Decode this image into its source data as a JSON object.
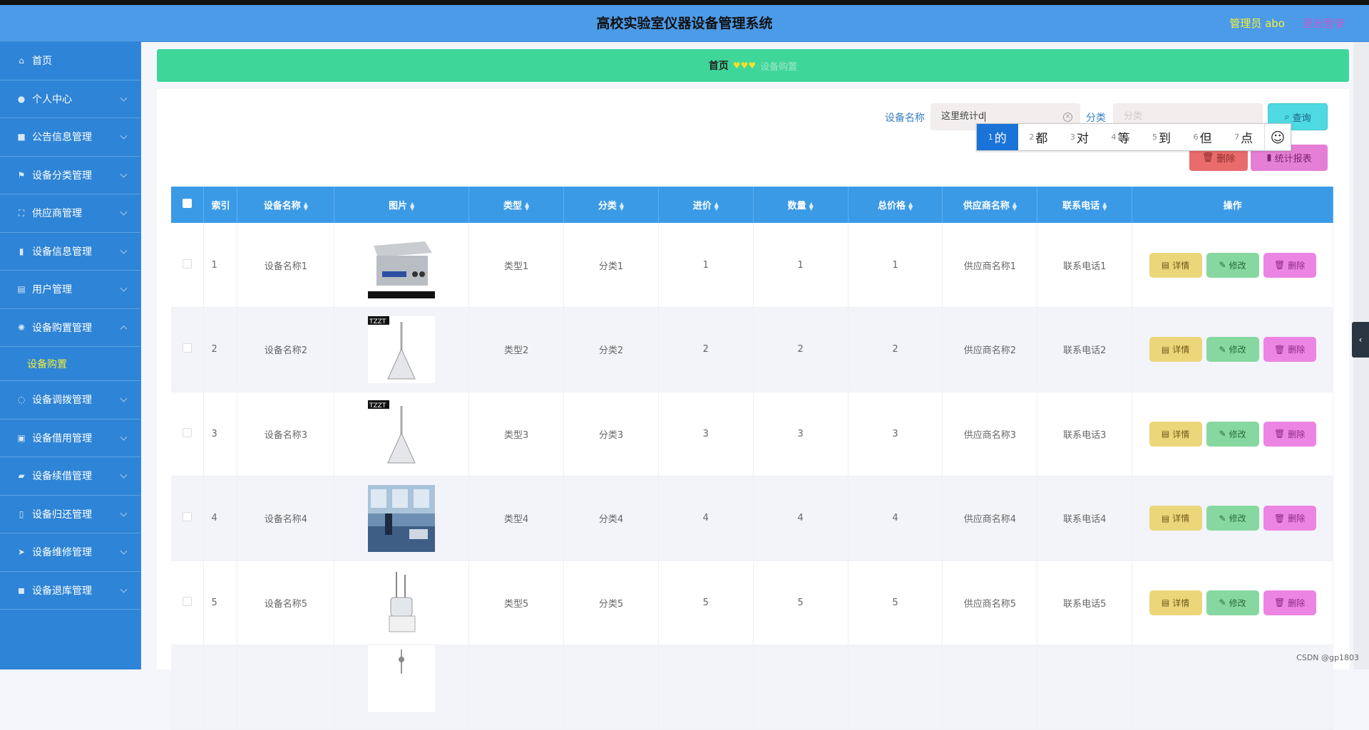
{
  "header": {
    "title": "高校实验室仪器设备管理系统",
    "admin": "管理员 abo",
    "logout": "退出登录"
  },
  "sidebar": {
    "items": [
      {
        "label": "首页",
        "icon": "home-icon",
        "glyph": "⌂"
      },
      {
        "label": "个人中心",
        "icon": "user-icon",
        "glyph": "●"
      },
      {
        "label": "公告信息管理",
        "icon": "briefcase-icon",
        "glyph": "■"
      },
      {
        "label": "设备分类管理",
        "icon": "flag-icon",
        "glyph": "⚑"
      },
      {
        "label": "供应商管理",
        "icon": "fullscreen-icon",
        "glyph": "⛶"
      },
      {
        "label": "设备信息管理",
        "icon": "bar-chart-icon",
        "glyph": "▮"
      },
      {
        "label": "用户管理",
        "icon": "document-icon",
        "glyph": "▤"
      },
      {
        "label": "设备购置管理",
        "icon": "settings-icon",
        "glyph": "✺"
      },
      {
        "label": "设备调拨管理",
        "icon": "loading-icon",
        "glyph": "◌"
      },
      {
        "label": "设备借用管理",
        "icon": "clipboard-icon",
        "glyph": "▣"
      },
      {
        "label": "设备续借管理",
        "icon": "folder-icon",
        "glyph": "▰"
      },
      {
        "label": "设备归还管理",
        "icon": "mobile-icon",
        "glyph": "▯"
      },
      {
        "label": "设备维修管理",
        "icon": "send-icon",
        "glyph": "➤"
      },
      {
        "label": "设备退库管理",
        "icon": "camera-icon",
        "glyph": "◼"
      }
    ],
    "sub_item": "设备购置"
  },
  "breadcrumb": {
    "home": "首页",
    "separator": "♥♥♥",
    "current": "设备购置"
  },
  "search": {
    "name_label": "设备名称",
    "name_value": "这里统计d",
    "category_label": "分类",
    "category_placeholder": "分类",
    "query_label": "查询"
  },
  "ime": {
    "candidates": [
      {
        "num": "1",
        "text": "的"
      },
      {
        "num": "2",
        "text": "都"
      },
      {
        "num": "3",
        "text": "对"
      },
      {
        "num": "4",
        "text": "等"
      },
      {
        "num": "5",
        "text": "到"
      },
      {
        "num": "6",
        "text": "但"
      },
      {
        "num": "7",
        "text": "点"
      }
    ],
    "emoji": "☺"
  },
  "actions": {
    "delete_label": "删除",
    "report_label": "统计报表"
  },
  "table": {
    "headers": [
      "索引",
      "设备名称",
      "图片",
      "类型",
      "分类",
      "进价",
      "数量",
      "总价格",
      "供应商名称",
      "联系电话",
      "操作"
    ],
    "row_buttons": {
      "detail": "详情",
      "edit": "修改",
      "delete": "删除"
    },
    "rows": [
      {
        "index": "1",
        "name": "设备名称1",
        "type": "类型1",
        "category": "分类1",
        "price": "1",
        "qty": "1",
        "total": "1",
        "supplier": "供应商名称1",
        "phone": "联系电话1"
      },
      {
        "index": "2",
        "name": "设备名称2",
        "type": "类型2",
        "category": "分类2",
        "price": "2",
        "qty": "2",
        "total": "2",
        "supplier": "供应商名称2",
        "phone": "联系电话2"
      },
      {
        "index": "3",
        "name": "设备名称3",
        "type": "类型3",
        "category": "分类3",
        "price": "3",
        "qty": "3",
        "total": "3",
        "supplier": "供应商名称3",
        "phone": "联系电话3"
      },
      {
        "index": "4",
        "name": "设备名称4",
        "type": "类型4",
        "category": "分类4",
        "price": "4",
        "qty": "4",
        "total": "4",
        "supplier": "供应商名称4",
        "phone": "联系电话4"
      },
      {
        "index": "5",
        "name": "设备名称5",
        "type": "类型5",
        "category": "分类5",
        "price": "5",
        "qty": "5",
        "total": "5",
        "supplier": "供应商名称5",
        "phone": "联系电话5"
      },
      {
        "index": "",
        "name": "",
        "type": "",
        "category": "",
        "price": "",
        "qty": "",
        "total": "",
        "supplier": "",
        "phone": ""
      }
    ]
  },
  "watermark": "CSDN @gp1803",
  "side_tab_glyph": "‹",
  "colors": {
    "header": "#4c9be8",
    "sidebar": "#2e84d6",
    "breadcrumb": "#3fd69a",
    "table_header": "#3b9ae6",
    "active_submenu": "#f3ec3b"
  }
}
